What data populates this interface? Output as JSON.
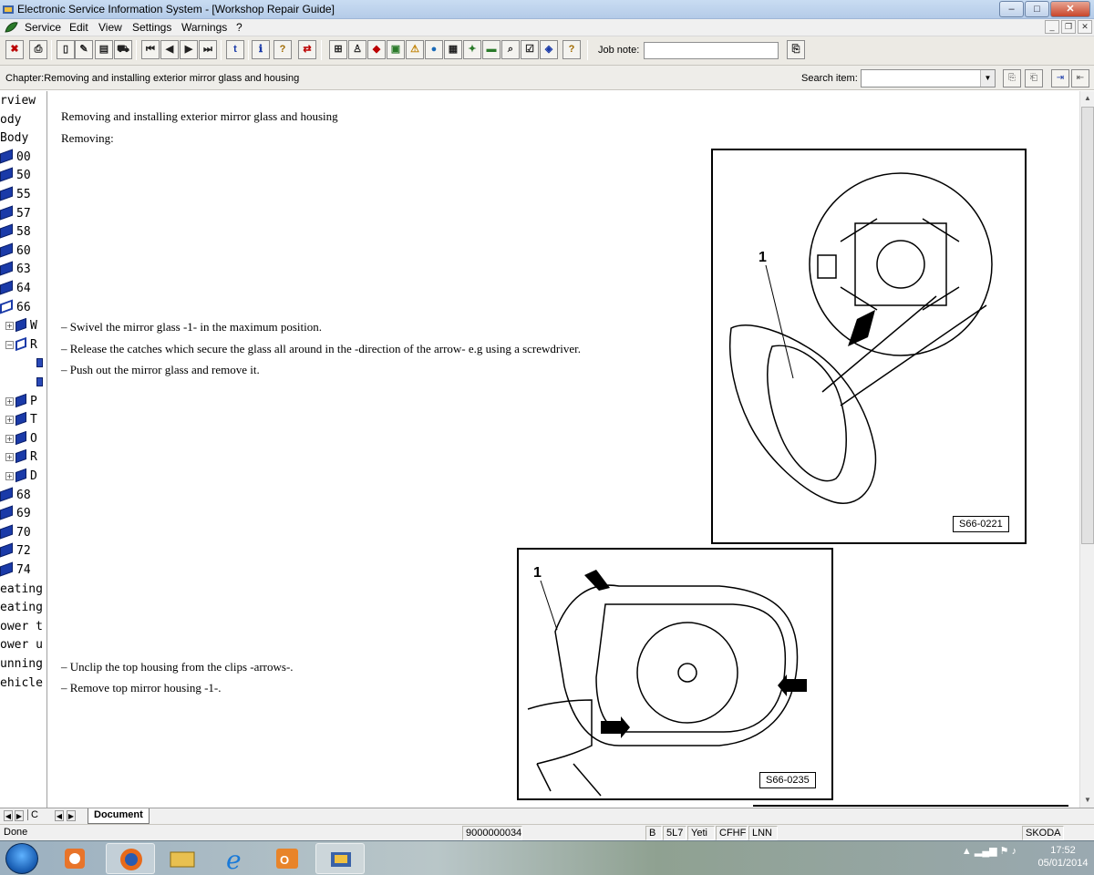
{
  "window": {
    "title": "Electronic Service Information System - [Workshop Repair Guide]",
    "buttons": {
      "minimize": "–",
      "maximize": "□",
      "close": "✕"
    }
  },
  "menu": {
    "items": [
      "Service",
      "Edit",
      "View",
      "Settings",
      "Warnings",
      "?"
    ]
  },
  "toolbar": {
    "job_note_label": "Job note:",
    "job_note_value": ""
  },
  "chapter": {
    "text": "Chapter:Removing and installing exterior mirror glass and housing",
    "search_label": "Search item:",
    "search_value": ""
  },
  "tree": {
    "rows": [
      {
        "label": "rview",
        "kind": "text"
      },
      {
        "label": "ody",
        "kind": "text"
      },
      {
        "label": "Body",
        "kind": "text"
      },
      {
        "label": "00",
        "kind": "book"
      },
      {
        "label": "50",
        "kind": "book"
      },
      {
        "label": "55",
        "kind": "book"
      },
      {
        "label": "57",
        "kind": "book"
      },
      {
        "label": "58",
        "kind": "book"
      },
      {
        "label": "60",
        "kind": "book"
      },
      {
        "label": "63",
        "kind": "book"
      },
      {
        "label": "64",
        "kind": "book"
      },
      {
        "label": "66",
        "kind": "open"
      },
      {
        "label": "W",
        "kind": "plusbook"
      },
      {
        "label": "R",
        "kind": "minusopen"
      },
      {
        "label": "",
        "kind": "doc"
      },
      {
        "label": "",
        "kind": "doc"
      },
      {
        "label": "P",
        "kind": "plusbook"
      },
      {
        "label": "T",
        "kind": "plusbook"
      },
      {
        "label": "O",
        "kind": "plusbook"
      },
      {
        "label": "R",
        "kind": "plusbook"
      },
      {
        "label": "D",
        "kind": "plusbook"
      },
      {
        "label": "68",
        "kind": "book"
      },
      {
        "label": "69",
        "kind": "book"
      },
      {
        "label": "70",
        "kind": "book"
      },
      {
        "label": "72",
        "kind": "book"
      },
      {
        "label": "74",
        "kind": "book"
      },
      {
        "label": "eating",
        "kind": "text"
      },
      {
        "label": "eating",
        "kind": "text"
      },
      {
        "label": "ower t",
        "kind": "text"
      },
      {
        "label": "ower u",
        "kind": "text"
      },
      {
        "label": "unning",
        "kind": "text"
      },
      {
        "label": "ehicle",
        "kind": "text"
      }
    ]
  },
  "document": {
    "heading": "Removing and installing exterior mirror glass and housing",
    "subheading": "Removing:",
    "steps_1": [
      "–  Swivel the mirror glass -1- in the maximum position.",
      "–  Release the catches which secure the glass all around in the -direction of the arrow- e.g using a screwdriver.",
      "–  Push out the mirror glass and remove it."
    ],
    "steps_2": [
      "–  Unclip the top housing from the clips -arrows-.",
      "–  Remove top mirror housing -1-."
    ],
    "figure_1": {
      "label": "S66-0221",
      "callout": "1"
    },
    "figure_2": {
      "label": "S66-0235",
      "callout": "1"
    }
  },
  "tabs": {
    "left_tab": "C",
    "doc_tab": "Document"
  },
  "status": {
    "left": "Done",
    "code": "9000000034",
    "b": "B",
    "model_code": "5L7",
    "model": "Yeti",
    "engine": "CFHF",
    "gearbox": "LNN",
    "brand": "SKODA"
  },
  "taskbar": {
    "time": "17:52",
    "date": "05/01/2014"
  },
  "colors": {
    "book_blue": "#1a3aa8",
    "titlebar": "#b4cbe8",
    "close_red": "#c8452a"
  }
}
